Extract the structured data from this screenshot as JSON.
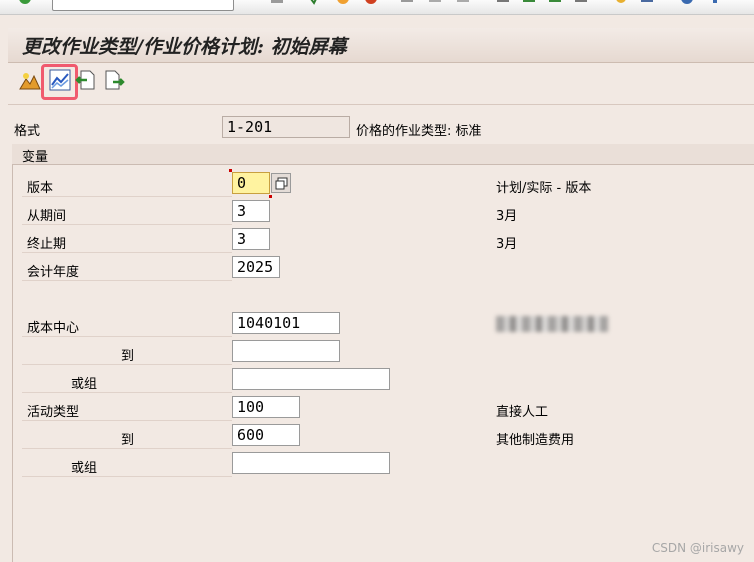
{
  "title": "更改作业类型/作业价格计划: 初始屏幕",
  "header": {
    "format_label": "格式",
    "format_value": "1-201",
    "format_desc": "价格的作业类型: 标准"
  },
  "group": {
    "title": "变量",
    "version": {
      "label": "版本",
      "value": "0",
      "desc": "计划/实际 - 版本"
    },
    "from_period": {
      "label": "从期间",
      "value": "3",
      "desc": "3月"
    },
    "to_period": {
      "label": "终止期",
      "value": "3",
      "desc": "3月"
    },
    "fiscal_year": {
      "label": "会计年度",
      "value": "2025"
    },
    "cost_center": {
      "label": "成本中心",
      "value": "1040101",
      "to_label": "到",
      "to_value": "",
      "or_group_label": "或组",
      "or_group_value": ""
    },
    "activity_type": {
      "label": "活动类型",
      "value": "100",
      "desc": "直接人工",
      "to_label": "到",
      "to_value": "600",
      "to_desc": "其他制造费用",
      "or_group_label": "或组",
      "or_group_value": ""
    }
  },
  "watermark": "CSDN @irisawy",
  "colors": {
    "highlight": "#f05a6e",
    "background": "#f2e9e3"
  }
}
